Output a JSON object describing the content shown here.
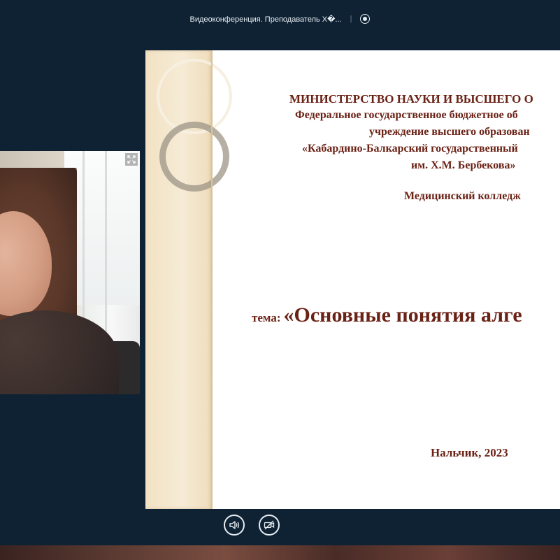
{
  "conference": {
    "title": "Видеоконференция. Преподаватель Х�..."
  },
  "slide": {
    "ministry": "МИНИСТЕРСТВО НАУКИ И ВЫСШЕГО О",
    "institution_line1": "Федеральное государственное бюджетное об",
    "institution_line2": "учреждение высшего образован",
    "institution_line3": "«Кабардино-Балкарский государственный",
    "institution_line4": "им. Х.М. Бербекова»",
    "college": "Медицинский колледж",
    "topic_label": "тема:",
    "topic_title": "«Основные понятия алге",
    "city_year": "Нальчик, 2023"
  },
  "icons": {
    "record": "record-icon",
    "expand": "expand-icon",
    "audio": "speaker-icon",
    "video": "camera-off-icon"
  },
  "colors": {
    "background": "#0f2233",
    "slide_text": "#6b2216",
    "slide_strip": "#f2e2c4"
  }
}
